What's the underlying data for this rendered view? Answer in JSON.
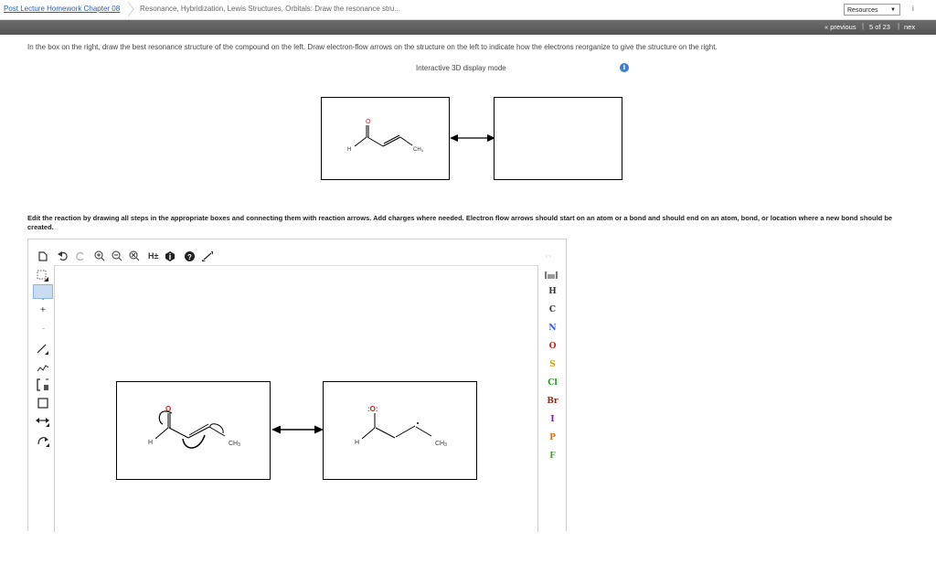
{
  "header": {
    "course_link": "Post Lecture Homework Chapter 08",
    "current_title": "Resonance, Hybridization, Lewis Structures, Orbitals: Draw the resonance stru...",
    "resources_label": "Resources",
    "edge_mark": "i"
  },
  "nav": {
    "previous": "« previous",
    "counter": "5 of 23",
    "next": "nex",
    "separator": "|"
  },
  "question": {
    "instruction": "In the box on the right, draw the best resonance structure of the compound on the left. Draw electron-flow arrows on the structure on the left to indicate how the electrons reorganize to give the structure on the right.",
    "display_mode": "Interactive 3D display mode",
    "info_symbol": "i"
  },
  "molecule_labels": {
    "oxygen": "O",
    "hydrogen": "H",
    "methyl": "CH",
    "methyl_sub": "3",
    "oxygen_lp": ":O:",
    "oxygen_lp_dots": "·  ·"
  },
  "editor": {
    "prompt": "Edit the reaction by drawing all steps in the appropriate boxes and connecting them with reaction arrows. Add charges where needed. Electron flow arrows should start on an atom or a bond and should end on an atom, bond, or location where a new bond should be created.",
    "toolbar_icons": [
      "new-document",
      "undo",
      "redo",
      "zoom-in",
      "zoom-out",
      "zoom-reset",
      "explicit-hydrogens",
      "info",
      "help",
      "fullscreen"
    ],
    "hydrogen_toggle": "H±",
    "left_tools": [
      "select",
      "eraser",
      "positive-charge",
      "negative-charge",
      "bond",
      "chain",
      "bracket",
      "ring",
      "arrow",
      "curved-arrow"
    ],
    "plus": "+",
    "minus": "-",
    "elements": [
      "H",
      "C",
      "N",
      "O",
      "S",
      "Cl",
      "Br",
      "I",
      "P",
      "F"
    ],
    "element_colors": {
      "H": "#333333",
      "C": "#333333",
      "N": "#3050f8",
      "O": "#d02020",
      "S": "#c8a000",
      "Cl": "#1aa01a",
      "Br": "#8a2a1a",
      "I": "#7a1a9a",
      "P": "#e07000",
      "F": "#40a030"
    },
    "expand_hint": "‹ ›"
  }
}
